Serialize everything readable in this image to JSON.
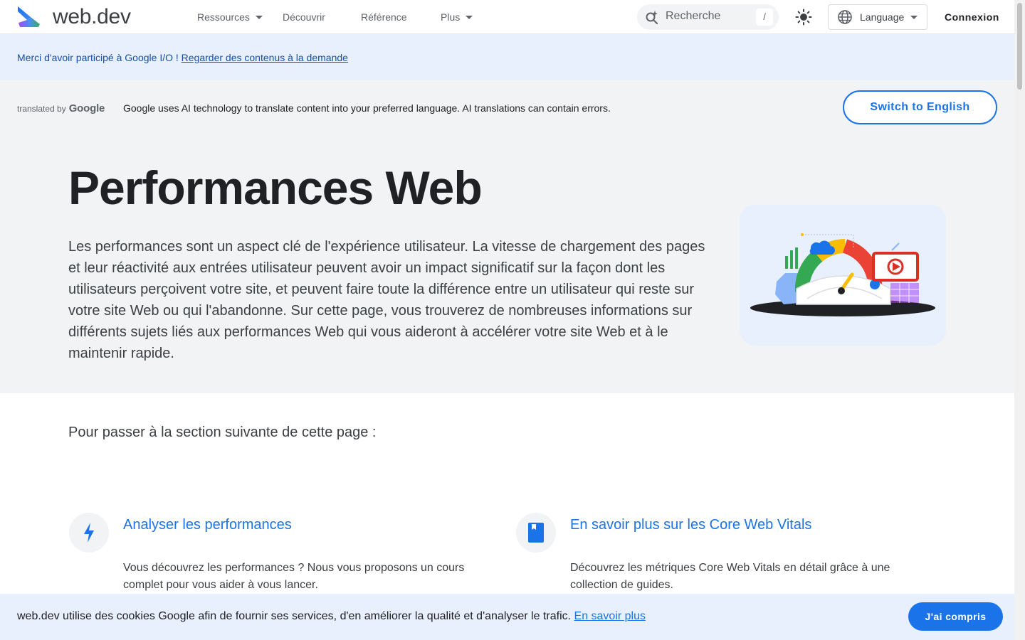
{
  "header": {
    "logo_text": "web.dev",
    "nav": [
      {
        "label": "Ressources"
      },
      {
        "label": "Découvrir"
      },
      {
        "label": "Référence"
      },
      {
        "label": "Plus"
      }
    ],
    "search_placeholder": "Recherche",
    "search_shortcut": "/",
    "language_label": "Language",
    "signin_label": "Connexion"
  },
  "banner": {
    "text": "Merci d'avoir participé à Google I/O ! ",
    "link": "Regarder des contenus à la demande"
  },
  "translation": {
    "translated_by": "translated by",
    "google": "Google",
    "notice": "Google uses AI technology to translate content into your preferred language. AI translations can contain errors.",
    "switch_label": "Switch to English"
  },
  "hero": {
    "title": "Performances Web",
    "description": "Les performances sont un aspect clé de l'expérience utilisateur. La vitesse de chargement des pages et leur réactivité aux entrées utilisateur peuvent avoir un impact significatif sur la façon dont les utilisateurs perçoivent votre site, et peuvent faire toute la différence entre un utilisateur qui reste sur votre site Web ou qui l'abandonne. Sur cette page, vous trouverez de nombreuses informations sur différents sujets liés aux performances Web qui vous aideront à accélérer votre site Web et à le maintenir rapide."
  },
  "main": {
    "jump_text": "Pour passer à la section suivante de cette page :",
    "cards": [
      {
        "icon": "lightning-icon",
        "title": "Analyser les performances",
        "desc": "Vous découvrez les performances ? Nous vous proposons un cours complet pour vous aider à vous lancer."
      },
      {
        "icon": "book-icon",
        "title": "En savoir plus sur les Core Web Vitals",
        "desc": "Découvrez les métriques Core Web Vitals en détail grâce à une collection de guides."
      }
    ]
  },
  "cookie": {
    "text": "web.dev utilise des cookies Google afin de fournir ses services, d'en améliorer la qualité et d'analyser le trafic. ",
    "link": "En savoir plus",
    "button": "J'ai compris"
  },
  "colors": {
    "accent": "#1a73e8",
    "banner_bg": "#e8f0fe",
    "hero_bg": "#f1f3f4"
  }
}
